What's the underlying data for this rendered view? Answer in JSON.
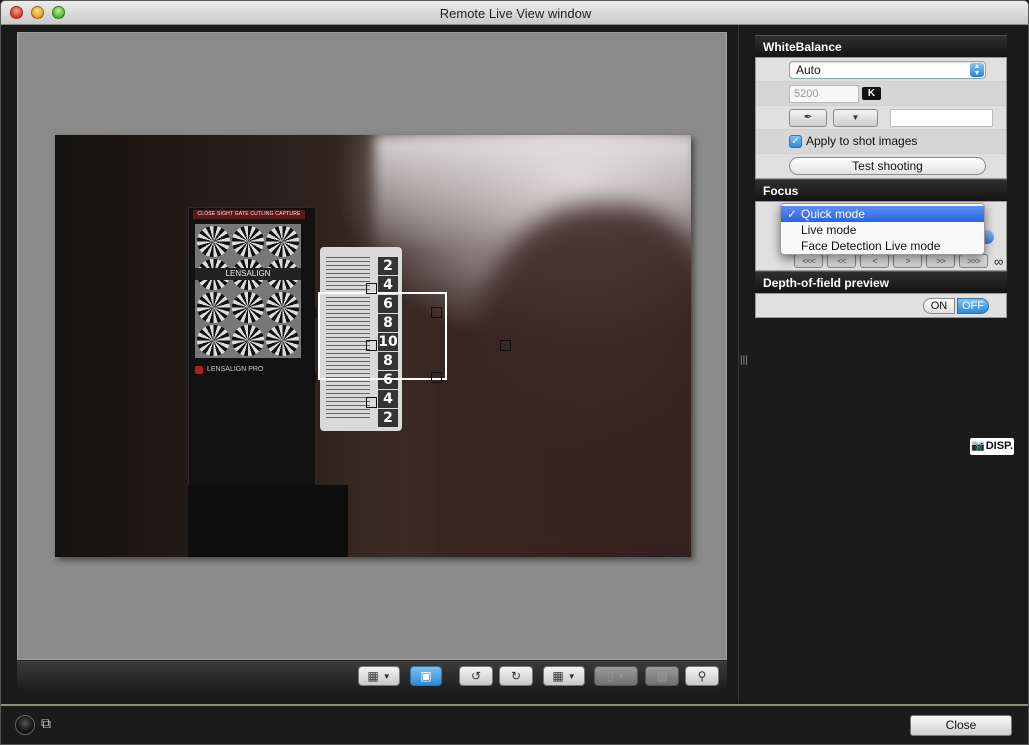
{
  "window": {
    "title": "Remote Live View window"
  },
  "toolbar": {
    "buttons": [
      "display-mode",
      "af-frame",
      "rotate-left",
      "rotate-right",
      "grid",
      "aspect",
      "histogram",
      "zoom"
    ]
  },
  "white_balance": {
    "header": "WhiteBalance",
    "mode": "Auto",
    "kelvin_placeholder": "5200",
    "kelvin_badge": "K",
    "apply_label": "Apply to shot images",
    "apply_checked": true,
    "test_shooting": "Test shooting"
  },
  "focus": {
    "header": "Focus",
    "menu": [
      {
        "label": "Quick mode",
        "selected": true
      },
      {
        "label": "Live mode",
        "selected": false
      },
      {
        "label": "Face Detection Live mode",
        "selected": false
      }
    ],
    "nav": [
      "<<<",
      "<<",
      "<",
      ">",
      ">>",
      ">>>"
    ],
    "infinity": "∞"
  },
  "dof": {
    "header": "Depth-of-field preview",
    "on": "ON",
    "off": "OFF",
    "state": "OFF"
  },
  "photo": {
    "target_header": "CLOSE SIGHT GATE CUTLING CAPTURE",
    "brand": "LENSALIGN",
    "brand2": "LENSALIGN PRO",
    "ruler_numbers": [
      "2",
      "4",
      "6",
      "8",
      "10",
      "8",
      "6",
      "4",
      "2"
    ]
  },
  "disp_label": "DISP.",
  "close_label": "Close",
  "colors": {
    "accent": "#2c8ad8",
    "menu_selection": "#2b63e1"
  }
}
